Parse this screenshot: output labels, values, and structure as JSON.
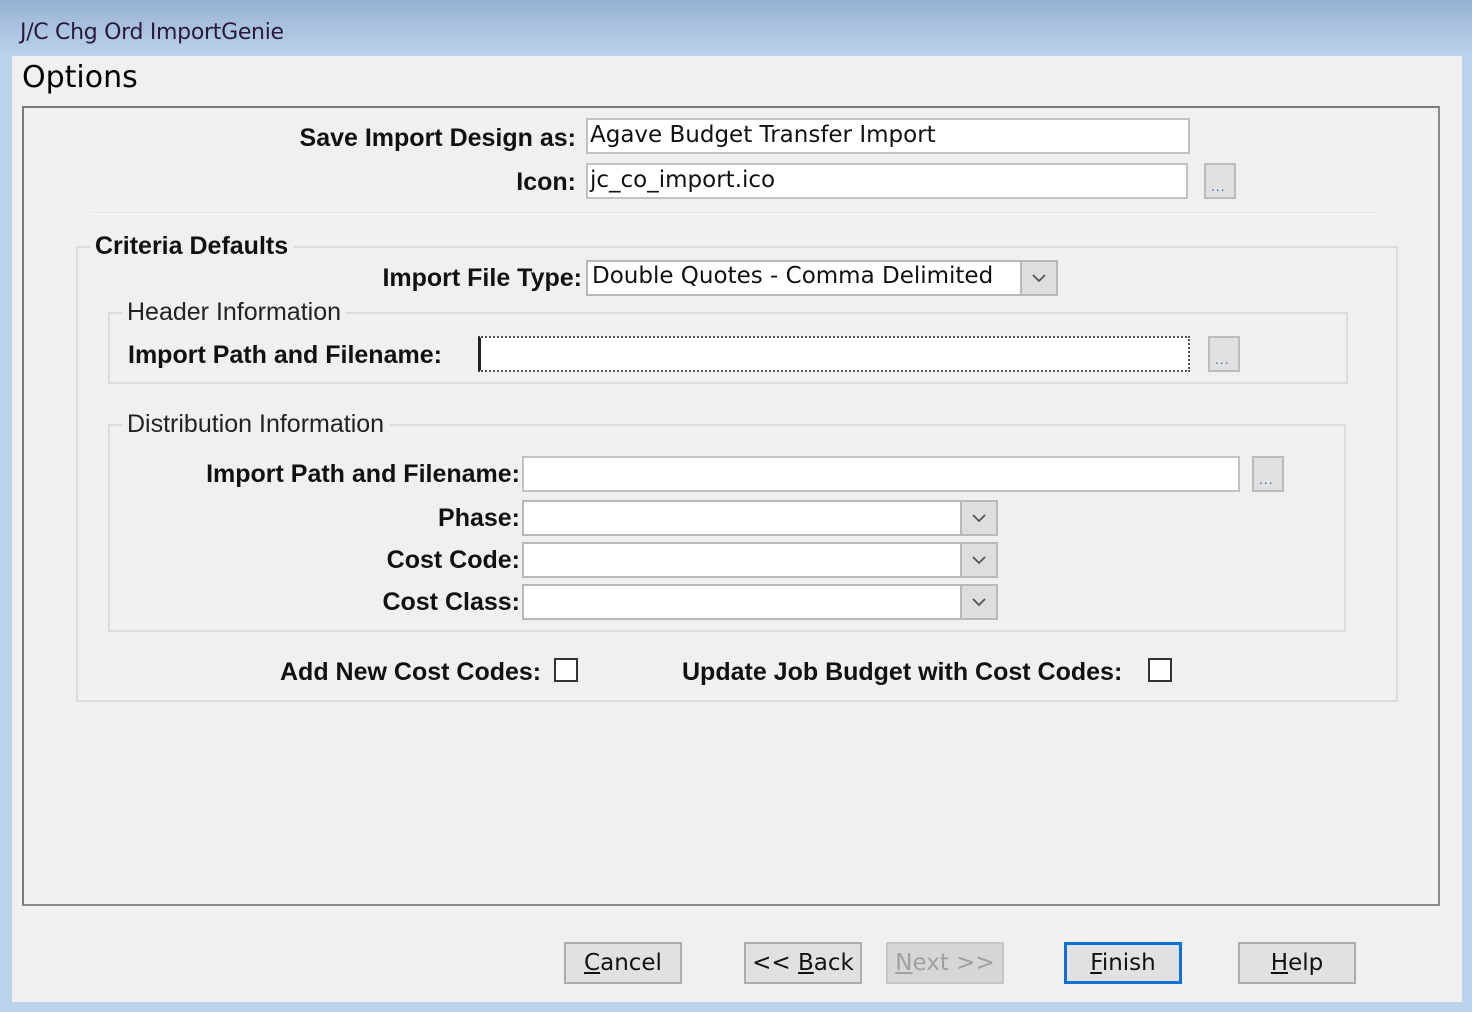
{
  "window": {
    "title": "J/C Chg Ord ImportGenie"
  },
  "page": {
    "heading": "Options"
  },
  "design": {
    "save_as_label": "Save Import Design as:",
    "save_as_value": "Agave Budget Transfer Import",
    "icon_label": "Icon:",
    "icon_value": "jc_co_import.ico",
    "browse_label": "..."
  },
  "criteria": {
    "title": "Criteria Defaults",
    "file_type_label": "Import File Type:",
    "file_type_value": "Double Quotes - Comma Delimited",
    "header": {
      "title": "Header Information",
      "path_label": "Import Path and Filename:",
      "path_value": "",
      "browse_label": "..."
    },
    "distribution": {
      "title": "Distribution Information",
      "path_label": "Import Path and Filename:",
      "path_value": "",
      "browse_label": "...",
      "phase_label": "Phase:",
      "phase_value": "",
      "cost_code_label": "Cost Code:",
      "cost_code_value": "",
      "cost_class_label": "Cost Class:",
      "cost_class_value": ""
    },
    "add_new_cost_codes_label": "Add New Cost Codes:",
    "add_new_cost_codes_checked": false,
    "update_budget_label": "Update Job Budget with Cost Codes:",
    "update_budget_checked": false
  },
  "buttons": {
    "cancel": {
      "mnemonic": "C",
      "rest": "ancel"
    },
    "back": {
      "prefix": "<< ",
      "mnemonic": "B",
      "rest": "ack"
    },
    "next": {
      "mnemonic": "N",
      "rest": "ext >>",
      "disabled": true
    },
    "finish": {
      "mnemonic": "F",
      "rest": "inish",
      "default": true
    },
    "help": {
      "mnemonic": "H",
      "rest": "elp"
    }
  },
  "colors": {
    "accent": "#0a72d4",
    "titlebar": "#bad2ea",
    "dialog_bg": "#f0f0f0"
  }
}
